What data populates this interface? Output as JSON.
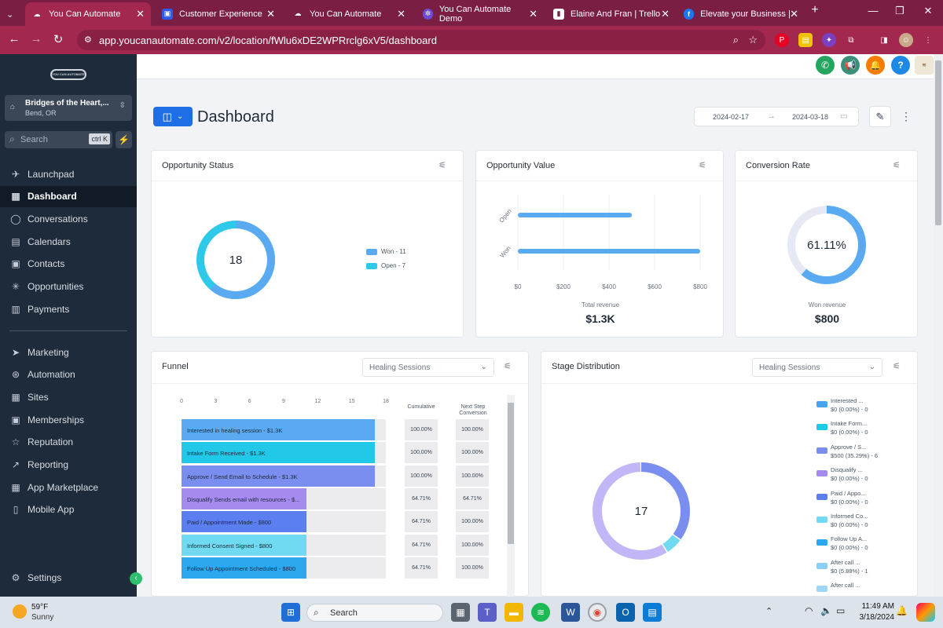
{
  "browser": {
    "tabs": [
      {
        "title": "You Can Automate",
        "icon": "cloud-logo-icon",
        "color": "#ffffff"
      },
      {
        "title": "Customer Experience",
        "icon": "square-app-icon",
        "color": "#2f5bea"
      },
      {
        "title": "You Can Automate",
        "icon": "cloud-logo-icon",
        "color": "#ffffff"
      },
      {
        "title": "You Can Automate Demo",
        "icon": "gear-app-icon",
        "color": "#6b4bd6"
      },
      {
        "title": "Elaine And Fran | Trello",
        "icon": "trello-icon",
        "color": "#ffffff"
      },
      {
        "title": "Elevate your Business | Fa",
        "icon": "facebook-icon",
        "color": "#1877f2"
      }
    ],
    "url": "app.youcanautomate.com/v2/location/fWlu6xDE2WPRrclg6xV5/dashboard"
  },
  "sidebar": {
    "logo_text": "YOU CAN AUTOMATE",
    "location_name": "Bridges of the Heart,...",
    "location_city": "Bend, OR",
    "search_placeholder": "Search",
    "search_shortcut": "ctrl K",
    "items": [
      {
        "label": "Launchpad",
        "icon": "rocket-icon"
      },
      {
        "label": "Dashboard",
        "icon": "grid-icon",
        "active": true
      },
      {
        "label": "Conversations",
        "icon": "chat-icon"
      },
      {
        "label": "Calendars",
        "icon": "calendar-icon"
      },
      {
        "label": "Contacts",
        "icon": "contacts-icon"
      },
      {
        "label": "Opportunities",
        "icon": "network-icon"
      },
      {
        "label": "Payments",
        "icon": "receipt-icon"
      }
    ],
    "items2": [
      {
        "label": "Marketing",
        "icon": "send-icon"
      },
      {
        "label": "Automation",
        "icon": "automation-icon"
      },
      {
        "label": "Sites",
        "icon": "sites-icon"
      },
      {
        "label": "Memberships",
        "icon": "memberships-icon"
      },
      {
        "label": "Reputation",
        "icon": "star-icon"
      },
      {
        "label": "Reporting",
        "icon": "trend-icon"
      },
      {
        "label": "App Marketplace",
        "icon": "apps-icon"
      },
      {
        "label": "Mobile App",
        "icon": "phone-icon"
      }
    ],
    "settings_label": "Settings"
  },
  "header": {
    "title": "Dashboard",
    "date_start": "2024-02-17",
    "date_end": "2024-03-18"
  },
  "opportunity_status": {
    "title": "Opportunity Status",
    "total": "18",
    "legend": [
      "Won - 11",
      "Open - 7"
    ],
    "colors": [
      "#5aaaf2",
      "#2ec9e8"
    ]
  },
  "opportunity_value": {
    "title": "Opportunity Value",
    "categories": [
      "Open",
      "Won"
    ],
    "values": [
      500,
      800
    ],
    "ticks": [
      "$0",
      "$200",
      "$400",
      "$600",
      "$800"
    ],
    "total_label": "Total revenue",
    "total_value": "$1.3K"
  },
  "conversion": {
    "title": "Conversion Rate",
    "value": "61.11%",
    "fraction": 0.6111,
    "won_label": "Won revenue",
    "won_value": "$800"
  },
  "funnel": {
    "title": "Funnel",
    "select": "Healing Sessions",
    "ticks": [
      "0",
      "3",
      "6",
      "9",
      "12",
      "15",
      "18"
    ],
    "col_cumulative": "Cumulative",
    "col_next": "Next Step Conversion",
    "rows": [
      {
        "label": "Interested in healing session - $1.3K",
        "count": 17,
        "cum": "100.00%",
        "next": "100.00%",
        "color": "#5aaaf2"
      },
      {
        "label": "Intake Form Received - $1.3K",
        "count": 17,
        "cum": "100.00%",
        "next": "100.00%",
        "color": "#22c8e8"
      },
      {
        "label": "Approve / Send Email to Schedule - $1.3K",
        "count": 17,
        "cum": "100.00%",
        "next": "100.00%",
        "color": "#7a8ef0"
      },
      {
        "label": "Disqualify Sends email with resources - $...",
        "count": 11,
        "cum": "64.71%",
        "next": "64.71%",
        "color": "#a58af0"
      },
      {
        "label": "Paid / Appointment Made - $800",
        "count": 11,
        "cum": "64.71%",
        "next": "100.00%",
        "color": "#5b7ef0"
      },
      {
        "label": "Informed Consent Signed - $800",
        "count": 11,
        "cum": "64.71%",
        "next": "100.00%",
        "color": "#6fdaf2"
      },
      {
        "label": "Follow Up Appointment Scheduled - $800",
        "count": 11,
        "cum": "64.71%",
        "next": "100.00%",
        "color": "#2ba8f0"
      }
    ]
  },
  "stage": {
    "title": "Stage Distribution",
    "select": "Healing Sessions",
    "total": "17",
    "legend": [
      {
        "name": "Interested ...",
        "value": "$0 (0.00%) - 0",
        "color": "#4aa3ee"
      },
      {
        "name": "Intake Form...",
        "value": "$0 (0.00%) - 0",
        "color": "#22c8e8"
      },
      {
        "name": "Approve / S...",
        "value": "$500 (35.29%) - 6",
        "color": "#7a8ef0"
      },
      {
        "name": "Disqualify ...",
        "value": "$0 (0.00%) - 0",
        "color": "#a58af0"
      },
      {
        "name": "Paid / Appo...",
        "value": "$0 (0.00%) - 0",
        "color": "#5b7ef0"
      },
      {
        "name": "Informed Co...",
        "value": "$0 (0.00%) - 0",
        "color": "#6fdaf2"
      },
      {
        "name": "Follow Up A...",
        "value": "$0 (0.00%) - 0",
        "color": "#2ba8f0"
      },
      {
        "name": "After call ...",
        "value": "$0 (5.88%) - 1",
        "color": "#8ad0f6"
      },
      {
        "name": "After call ...",
        "value": "",
        "color": "#9fd6f8"
      }
    ],
    "donut": [
      {
        "value": 6,
        "color": "#7a8ef0"
      },
      {
        "value": 1,
        "color": "#6fdaf2"
      },
      {
        "value": 10,
        "color": "#c3b6f6"
      }
    ]
  },
  "taskbar": {
    "weather_temp": "59°F",
    "weather_desc": "Sunny",
    "search_placeholder": "Search",
    "time": "11:49 AM",
    "date": "3/18/2024"
  }
}
